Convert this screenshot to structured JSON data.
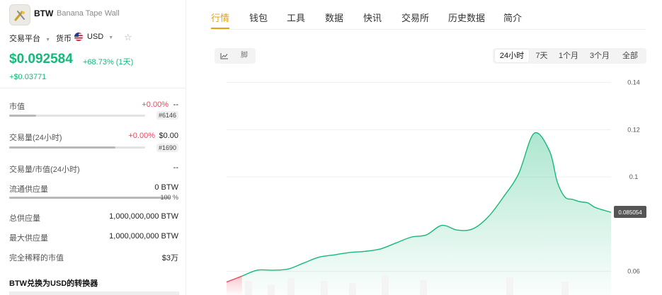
{
  "coin": {
    "symbol": "BTW",
    "name": "Banana Tape Wall"
  },
  "meta": {
    "platform_label": "交易平台",
    "currency_label": "货币",
    "currency_value": "USD"
  },
  "price": {
    "value": "$0.092584",
    "change_pct": "+68.73% (1天)",
    "change_abs": "+$0.03771"
  },
  "stats": {
    "market_cap": {
      "label": "市值",
      "change": "+0.00%",
      "value": "--",
      "rank": "#6146",
      "fill": 0.2
    },
    "volume": {
      "label": "交易量(24小时)",
      "change": "+0.00%",
      "value": "$0.00",
      "rank": "#1690",
      "fill": 0.78
    },
    "vol_mcap": {
      "label": "交易量/市值(24小时)",
      "value": "--"
    },
    "circulating": {
      "label": "流通供应量",
      "value": "0 BTW",
      "pct": "100 %",
      "fill": 1.0
    },
    "total_supply": {
      "label": "总供应量",
      "value": "1,000,000,000 BTW"
    },
    "max_supply": {
      "label": "最大供应量",
      "value": "1,000,000,000 BTW"
    },
    "fdv": {
      "label": "完全稀释的市值",
      "value": "$3万"
    }
  },
  "converter": {
    "title": "BTW兑换为USD的转换器"
  },
  "nav": {
    "tabs": [
      "行情",
      "钱包",
      "工具",
      "数据",
      "快讯",
      "交易所",
      "历史数据",
      "简介"
    ],
    "active": 0
  },
  "chart_controls": {
    "line_icon": "line-chart-icon",
    "candle_label": "脚"
  },
  "ranges": {
    "items": [
      "24小时",
      "7天",
      "1个月",
      "3个月",
      "全部"
    ],
    "active": 0
  },
  "colors": {
    "up": "#16b979",
    "down": "#e8485b",
    "accent": "#e4a016"
  },
  "chart_data": {
    "type": "area",
    "title": "",
    "xlabel": "",
    "ylabel": "",
    "ylim": [
      0.05,
      0.145
    ],
    "yticks": [
      0.06,
      0.1,
      0.12,
      0.14
    ],
    "grid": true,
    "current_label": "0.085054",
    "x": [
      0,
      4,
      8,
      12,
      16,
      20,
      24,
      28,
      32,
      36,
      40,
      44,
      48,
      52,
      56,
      60,
      64,
      68,
      72,
      76,
      80,
      84,
      86,
      88,
      90,
      92,
      94,
      96,
      100
    ],
    "values": [
      0.0555,
      0.058,
      0.0605,
      0.0605,
      0.061,
      0.0635,
      0.066,
      0.067,
      0.068,
      0.0685,
      0.0695,
      0.072,
      0.0745,
      0.0755,
      0.0795,
      0.0775,
      0.078,
      0.083,
      0.0915,
      0.1015,
      0.1185,
      0.111,
      0.098,
      0.0915,
      0.0905,
      0.0895,
      0.089,
      0.087,
      0.085054
    ],
    "down_until_index": 1
  }
}
